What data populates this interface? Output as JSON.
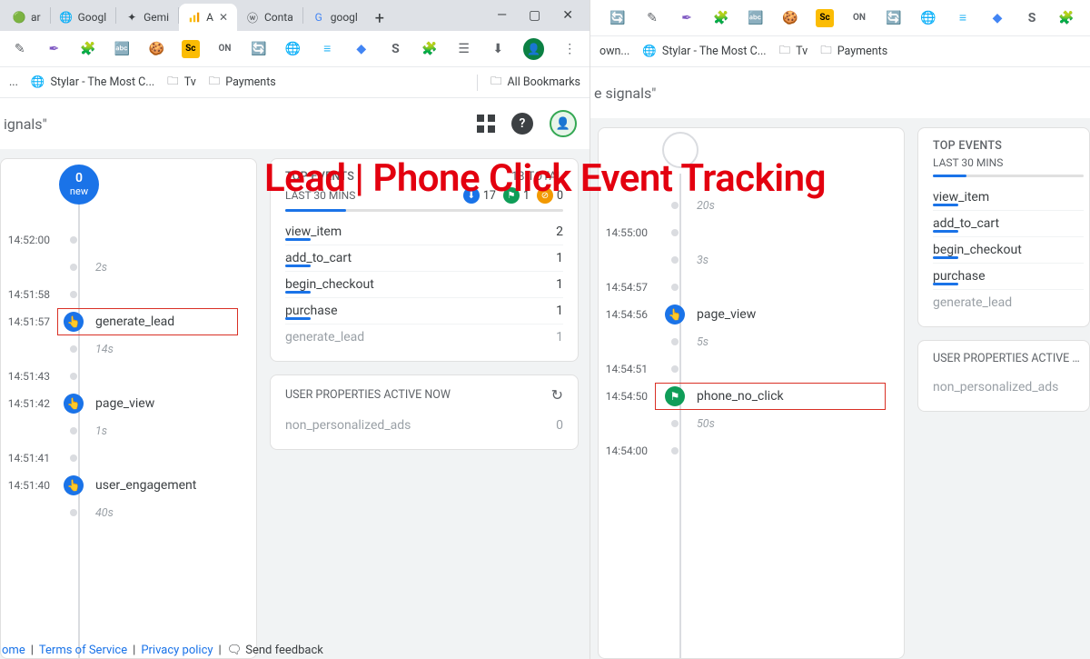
{
  "overlay": {
    "title": "Lead | Phone Click Event Tracking"
  },
  "left": {
    "tabs": [
      {
        "label": "ar"
      },
      {
        "label": "Googl"
      },
      {
        "label": "Gemi"
      },
      {
        "label": "A",
        "active": true
      },
      {
        "label": "Conta"
      },
      {
        "label": "googl"
      }
    ],
    "bookmarks": {
      "trunc": "...",
      "stylar": "Stylar - The Most C...",
      "tv": "Tv",
      "payments": "Payments",
      "all": "All Bookmarks"
    },
    "search_fragment": "ignals\"",
    "timeline": {
      "new_count": "0",
      "new_label": "new",
      "rows": [
        {
          "time": "14:52:00",
          "type": "tick"
        },
        {
          "time": "",
          "type": "gap",
          "gap": "2s"
        },
        {
          "time": "14:51:58",
          "type": "tick"
        },
        {
          "time": "14:51:57",
          "type": "event",
          "icon": "touch",
          "color": "blue",
          "label": "generate_lead",
          "highlight": true
        },
        {
          "time": "",
          "type": "gap",
          "gap": "14s"
        },
        {
          "time": "14:51:43",
          "type": "tick"
        },
        {
          "time": "14:51:42",
          "type": "event",
          "icon": "touch",
          "color": "blue",
          "label": "page_view"
        },
        {
          "time": "",
          "type": "gap",
          "gap": "1s"
        },
        {
          "time": "14:51:41",
          "type": "tick"
        },
        {
          "time": "14:51:40",
          "type": "event",
          "icon": "touch",
          "color": "blue",
          "label": "user_engagement"
        },
        {
          "time": "",
          "type": "gap",
          "gap": "40s"
        }
      ]
    },
    "top_events": {
      "title": "TOP EVENTS",
      "total": "18 TOTAL",
      "subtitle": "LAST 30 MINS",
      "counters": [
        {
          "color": "blue",
          "value": "17"
        },
        {
          "color": "green",
          "value": "1"
        },
        {
          "color": "orange",
          "value": "0"
        }
      ],
      "rows": [
        {
          "name": "view_item",
          "value": "2"
        },
        {
          "name": "add_to_cart",
          "value": "1"
        },
        {
          "name": "begin_checkout",
          "value": "1"
        },
        {
          "name": "purchase",
          "value": "1"
        },
        {
          "name": "generate_lead",
          "value": "1"
        }
      ]
    },
    "user_props": {
      "title": "USER PROPERTIES ACTIVE NOW",
      "rows": [
        {
          "name": "non_personalized_ads",
          "value": "0"
        }
      ]
    },
    "footer": {
      "home": "ome",
      "tos": "Terms of Service",
      "privacy": "Privacy policy",
      "feedback": "Send feedback"
    }
  },
  "right": {
    "bookmarks": {
      "own": "own...",
      "stylar": "Stylar - The Most C...",
      "tv": "Tv",
      "payments": "Payments"
    },
    "search_fragment": "e signals\"",
    "timeline": {
      "rows": [
        {
          "time": "",
          "type": "gap",
          "gap": "20s"
        },
        {
          "time": "14:55:00",
          "type": "tick"
        },
        {
          "time": "",
          "type": "gap",
          "gap": "3s"
        },
        {
          "time": "14:54:57",
          "type": "tick"
        },
        {
          "time": "14:54:56",
          "type": "event",
          "icon": "touch",
          "color": "blue",
          "label": "page_view"
        },
        {
          "time": "",
          "type": "gap",
          "gap": "5s"
        },
        {
          "time": "14:54:51",
          "type": "tick"
        },
        {
          "time": "14:54:50",
          "type": "event",
          "icon": "flag",
          "color": "green",
          "label": "phone_no_click",
          "highlight": true
        },
        {
          "time": "",
          "type": "gap",
          "gap": "50s"
        },
        {
          "time": "14:54:00",
          "type": "tick"
        }
      ]
    },
    "top_events": {
      "title": "TOP EVENTS",
      "subtitle": "LAST 30 MINS",
      "rows": [
        {
          "name": "view_item"
        },
        {
          "name": "add_to_cart"
        },
        {
          "name": "begin_checkout"
        },
        {
          "name": "purchase"
        },
        {
          "name": "generate_lead"
        }
      ]
    },
    "user_props": {
      "title": "USER PROPERTIES ACTIVE NO",
      "rows": [
        {
          "name": "non_personalized_ads"
        }
      ]
    }
  }
}
